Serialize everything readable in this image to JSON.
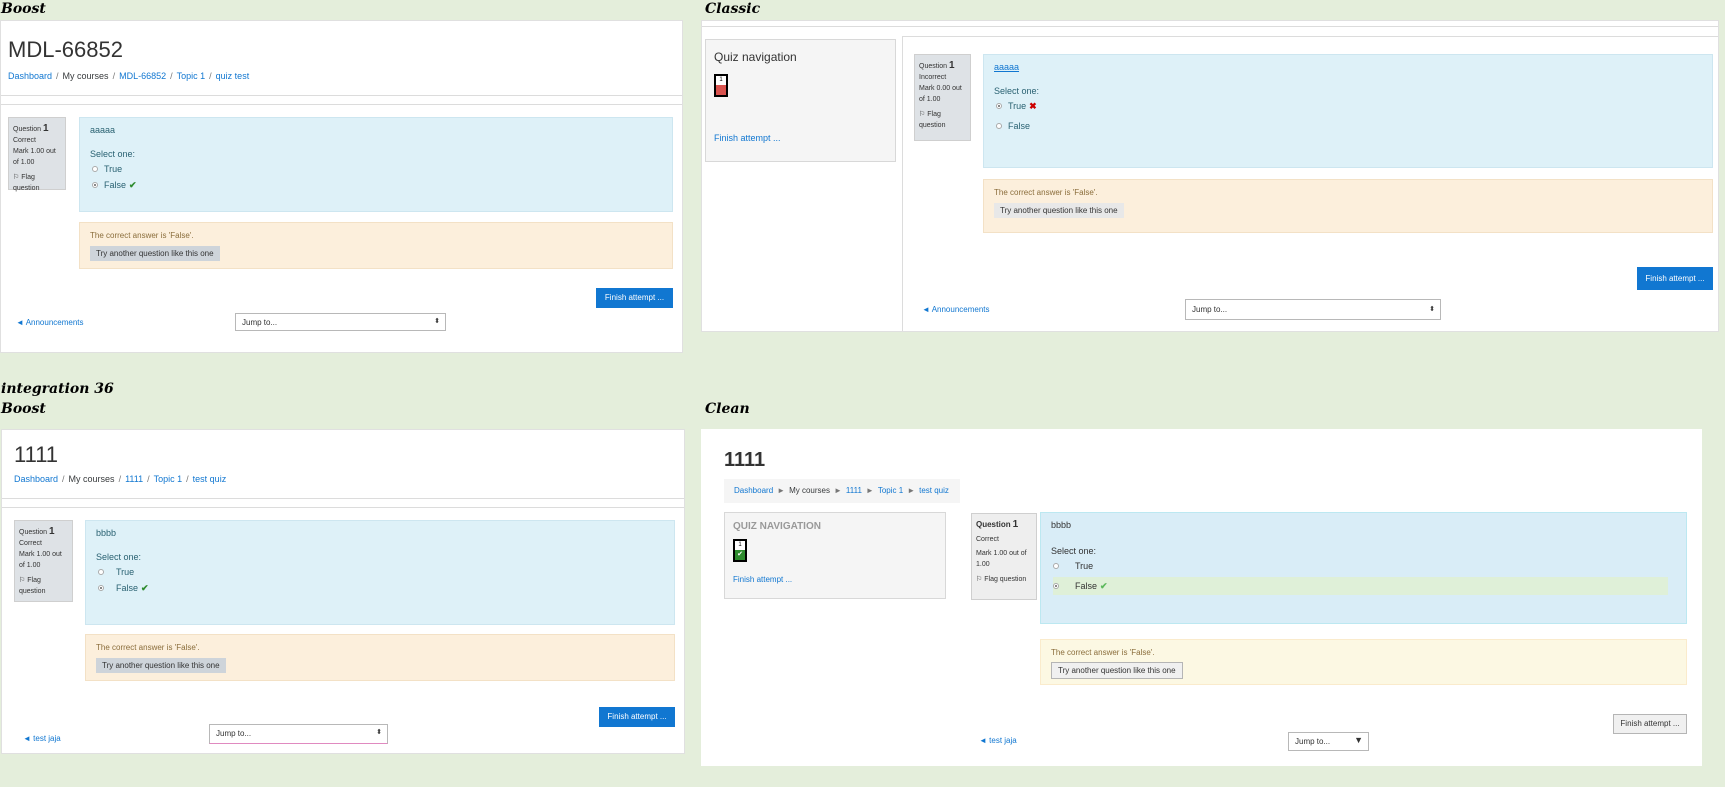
{
  "captions": {
    "boost_top": "Boost",
    "classic": "Classic",
    "integration": "integration 36",
    "boost_bottom": "Boost",
    "clean": "Clean"
  },
  "boost_top": {
    "title": "MDL-66852",
    "breadcrumb": [
      "Dashboard",
      "My courses",
      "MDL-66852",
      "Topic 1",
      "quiz test"
    ],
    "question_label": "Question",
    "question_number": "1",
    "state": "Correct",
    "mark": "Mark 1.00 out of 1.00",
    "flag": "Flag question",
    "question_text": "aaaaa",
    "prompt": "Select one:",
    "option_true": "True",
    "option_false": "False",
    "feedback": "The correct answer is 'False'.",
    "try_another": "Try another question like this one",
    "finish": "Finish attempt ...",
    "prev_link": "◄ Announcements",
    "jump": "Jump to..."
  },
  "classic": {
    "nav_title": "Quiz navigation",
    "nav_box_number": "1",
    "nav_finish": "Finish attempt ...",
    "question_label": "Question",
    "question_number": "1",
    "state": "Incorrect",
    "mark": "Mark 0.00 out of 1.00",
    "flag": "Flag question",
    "question_text": "aaaaa",
    "prompt": "Select one:",
    "option_true": "True",
    "option_false": "False",
    "feedback": "The correct answer is 'False'.",
    "try_another": "Try another question like this one",
    "finish": "Finish attempt ...",
    "prev_link": "◄ Announcements",
    "jump": "Jump to..."
  },
  "boost_bottom": {
    "title": "1111",
    "breadcrumb": [
      "Dashboard",
      "My courses",
      "1111",
      "Topic 1",
      "test quiz"
    ],
    "question_label": "Question",
    "question_number": "1",
    "state": "Correct",
    "mark": "Mark 1.00 out of 1.00",
    "flag": "Flag question",
    "question_text": "bbbb",
    "prompt": "Select one:",
    "option_true": "True",
    "option_false": "False",
    "feedback": "The correct answer is 'False'.",
    "try_another": "Try another question like this one",
    "finish": "Finish attempt ...",
    "prev_link": "◄ test jaja",
    "jump": "Jump to..."
  },
  "clean": {
    "title": "1111",
    "breadcrumb": [
      "Dashboard",
      "My courses",
      "1111",
      "Topic 1",
      "test quiz"
    ],
    "nav_title": "QUIZ NAVIGATION",
    "nav_box_number": "1",
    "nav_finish": "Finish attempt ...",
    "question_label": "Question",
    "question_number": "1",
    "state": "Correct",
    "mark": "Mark 1.00 out of 1.00",
    "flag": "Flag question",
    "question_text": "bbbb",
    "prompt": "Select one:",
    "option_true": "True",
    "option_false": "False",
    "feedback": "The correct answer is 'False'.",
    "try_another": "Try another question like this one",
    "finish": "Finish attempt ...",
    "prev_link": "◄ test jaja",
    "jump": "Jump to..."
  },
  "colors": {
    "page_bg": "#e4eedb",
    "link": "#1177d1",
    "formulation_bg": "#def1f8",
    "outcome_bg": "#fcefdc",
    "incorrect": "#d9534f",
    "correct": "#2e8b2e"
  }
}
